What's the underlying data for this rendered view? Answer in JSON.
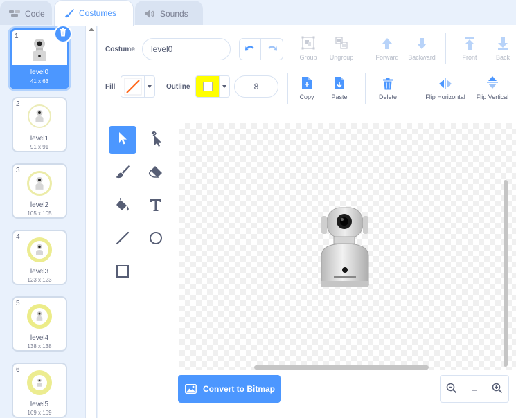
{
  "tabs": [
    {
      "label": "Code",
      "icon": "code-icon"
    },
    {
      "label": "Costumes",
      "icon": "brush-icon"
    },
    {
      "label": "Sounds",
      "icon": "speaker-icon"
    }
  ],
  "costumes": [
    {
      "num": "1",
      "name": "level0",
      "size": "41 x 63"
    },
    {
      "num": "2",
      "name": "level1",
      "size": "91 x 91"
    },
    {
      "num": "3",
      "name": "level2",
      "size": "105 x 105"
    },
    {
      "num": "4",
      "name": "level3",
      "size": "123 x 123"
    },
    {
      "num": "5",
      "name": "level4",
      "size": "138 x 138"
    },
    {
      "num": "6",
      "name": "level5",
      "size": "169 x 169"
    }
  ],
  "toolbar": {
    "costume_label": "Costume",
    "costume_name": "level0",
    "group": "Group",
    "ungroup": "Ungroup",
    "forward": "Forward",
    "backward": "Backward",
    "front": "Front",
    "back": "Back",
    "fill_label": "Fill",
    "outline_label": "Outline",
    "outline_size": "8",
    "copy": "Copy",
    "paste": "Paste",
    "delete": "Delete",
    "flip_horizontal": "Flip Horizontal",
    "flip_vertical": "Flip Vertical"
  },
  "colors": {
    "accent": "#4c97ff",
    "fill_stroke": "#ff6a1f",
    "outline": "#ffff00",
    "selected_ring": "#e8e89a"
  },
  "canvas": {
    "convert_button": "Convert to Bitmap",
    "zoom_out": "−",
    "zoom_reset": "=",
    "zoom_in": "+"
  }
}
